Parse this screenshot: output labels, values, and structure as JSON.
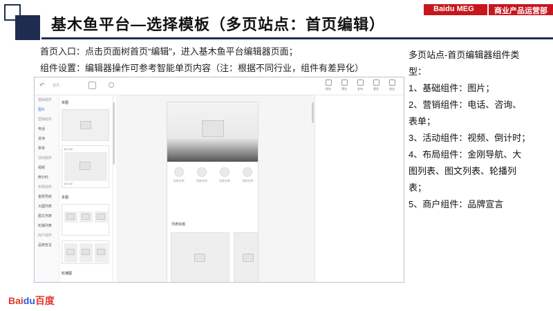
{
  "slide": {
    "title": "基木鱼平台—选择模板（多页站点：首页编辑）",
    "brand_left": "Baidu MEG",
    "brand_right": "商业产品运营部",
    "intro_line1": "首页入口：点击页面树首页“编辑”，进入基木鱼平台编辑器页面；",
    "intro_line2": "组件设置：编辑器操作可参考智能单页内容（注：根据不同行业，组件有差异化）",
    "logo_bai": "Bai",
    "logo_du": "du",
    "logo_text": "百度"
  },
  "right_text": {
    "lines": [
      "多页站点-首页编辑器组件类",
      "型：",
      "1、基础组件：图片；",
      "2、营销组件：电话、咨询、",
      "表单；",
      "3、活动组件：视频、倒计时；",
      "4、布局组件：金刚导航、大",
      "图列表、图文列表、轮播列",
      "表；",
      "5、商户组件：品牌宣言"
    ]
  },
  "editor": {
    "toolbar": {
      "back_icon": "↶",
      "page_name": "首页",
      "actions": [
        "保存",
        "预览",
        "发布",
        "更多",
        "退出"
      ]
    },
    "nav": [
      {
        "label": "基础组件",
        "type": "group"
      },
      {
        "label": "图片",
        "type": "active"
      },
      {
        "label": "营销组件",
        "type": "group"
      },
      {
        "label": "电话",
        "type": "item"
      },
      {
        "label": "咨询",
        "type": "item"
      },
      {
        "label": "表单",
        "type": "item"
      },
      {
        "label": "活动组件",
        "type": "group"
      },
      {
        "label": "视频",
        "type": "item"
      },
      {
        "label": "倒计时",
        "type": "item"
      },
      {
        "label": "布局组件",
        "type": "group"
      },
      {
        "label": "金刚导航",
        "type": "item"
      },
      {
        "label": "大图列表",
        "type": "item"
      },
      {
        "label": "图文列表",
        "type": "item"
      },
      {
        "label": "轮播列表",
        "type": "item"
      },
      {
        "label": "商户组件",
        "type": "group"
      },
      {
        "label": "品牌宣言",
        "type": "item"
      }
    ],
    "panel": {
      "section1": "单图",
      "card_caption": "图片标题",
      "section2": "多图",
      "section3": "轮播图"
    },
    "phone": {
      "nav_items": [
        "导航名称",
        "导航名称",
        "导航名称",
        "导航名称"
      ],
      "list_title": "列表标题"
    }
  }
}
